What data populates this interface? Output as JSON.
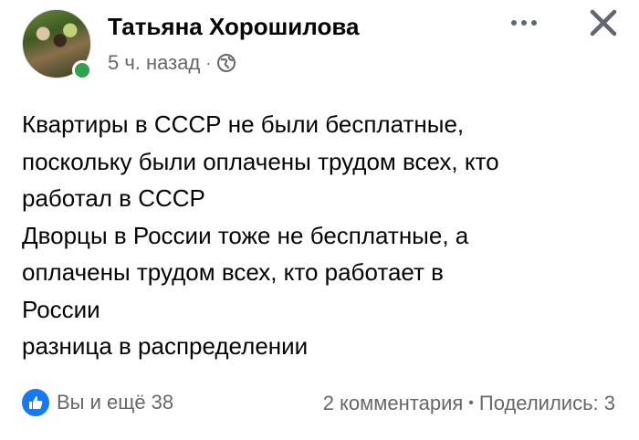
{
  "author": {
    "name": "Татьяна Хорошилова",
    "online": true
  },
  "meta": {
    "time": "5 ч. назад",
    "separator": "·",
    "privacy_icon": "globe-icon"
  },
  "header_actions": {
    "more_icon": "more-horizontal-icon",
    "close_icon": "close-icon"
  },
  "post": {
    "lines": [
      "Квартиры в СССР не были бесплатные,",
      "поскольку были оплачены трудом всех, кто",
      "работал в СССР",
      "Дворцы в России тоже не бесплатные, а",
      "оплачены трудом всех, кто работает в",
      "России",
      "разница в распределении"
    ]
  },
  "footer": {
    "reaction_icon": "like-icon",
    "reactions_text": "Вы и ещё 38",
    "comments_text": "2 комментария",
    "separator": "•",
    "shares_text": "Поделились: 3"
  },
  "colors": {
    "accent": "#1877f2",
    "online": "#31a24c",
    "secondary_text": "#65676b",
    "primary_text": "#050505"
  }
}
